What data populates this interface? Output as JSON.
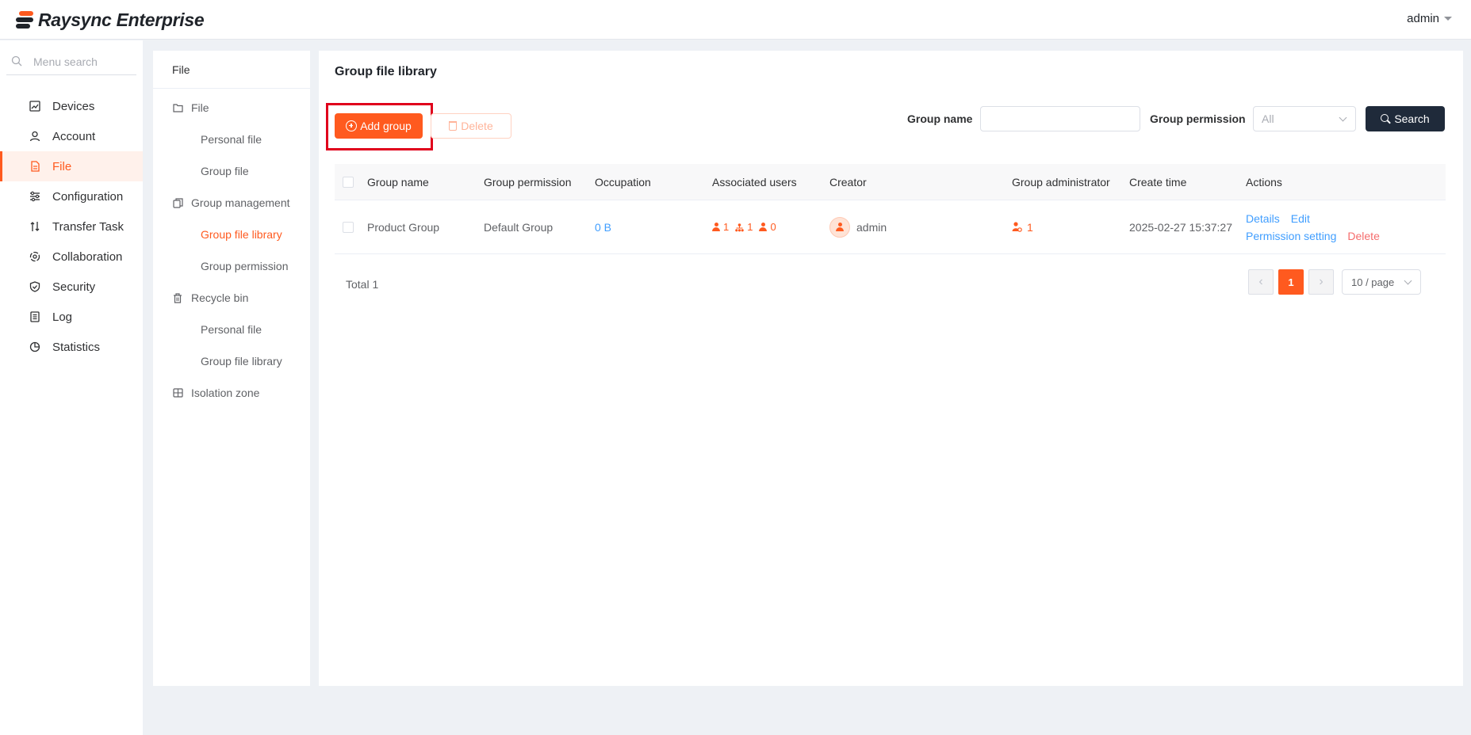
{
  "app": {
    "name": "Raysync Enterprise",
    "user": "admin"
  },
  "colors": {
    "accent": "#ff5a1f",
    "link": "#409eff",
    "danger": "#f56c6c",
    "dark_button": "#1f2a3a"
  },
  "sidebar": {
    "search_placeholder": "Menu search",
    "items": [
      {
        "label": "Devices",
        "icon": "monitor-chart-icon"
      },
      {
        "label": "Account",
        "icon": "user-icon"
      },
      {
        "label": "File",
        "icon": "document-icon",
        "active": true
      },
      {
        "label": "Configuration",
        "icon": "sliders-icon"
      },
      {
        "label": "Transfer Task",
        "icon": "transfer-arrows-icon"
      },
      {
        "label": "Collaboration",
        "icon": "collaboration-icon"
      },
      {
        "label": "Security",
        "icon": "shield-icon"
      },
      {
        "label": "Log",
        "icon": "log-list-icon"
      },
      {
        "label": "Statistics",
        "icon": "pie-chart-icon"
      }
    ]
  },
  "subnav": {
    "title": "File",
    "groups": [
      {
        "label": "File",
        "icon": "folder-icon",
        "items": [
          "Personal file",
          "Group file"
        ]
      },
      {
        "label": "Group management",
        "icon": "group-files-icon",
        "items": [
          "Group file library",
          "Group permission"
        ]
      },
      {
        "label": "Recycle bin",
        "icon": "trash-icon",
        "items": [
          "Personal file",
          "Group file library"
        ]
      },
      {
        "label": "Isolation zone",
        "icon": "isolation-icon",
        "items": []
      }
    ],
    "active_item": "Group file library"
  },
  "main": {
    "title": "Group file library",
    "add_button": "Add group",
    "delete_button": "Delete",
    "filters": {
      "group_name_label": "Group name",
      "group_name_value": "",
      "group_permission_label": "Group permission",
      "group_permission_value": "All",
      "search_button": "Search"
    },
    "table": {
      "columns": [
        "Group name",
        "Group permission",
        "Occupation",
        "Associated users",
        "Creator",
        "Group administrator",
        "Create time",
        "Actions"
      ],
      "rows": [
        {
          "group_name": "Product Group",
          "group_permission": "Default Group",
          "occupation": "0 B",
          "associated_users": {
            "users": "1",
            "departments": "1",
            "groups": "0"
          },
          "creator": "admin",
          "group_admin_count": "1",
          "create_time": "2025-02-27 15:37:27",
          "actions": [
            "Details",
            "Edit",
            "Permission setting",
            "Delete"
          ]
        }
      ]
    },
    "pagination": {
      "total": "Total 1",
      "current_page": "1",
      "page_size": "10 / page"
    }
  }
}
